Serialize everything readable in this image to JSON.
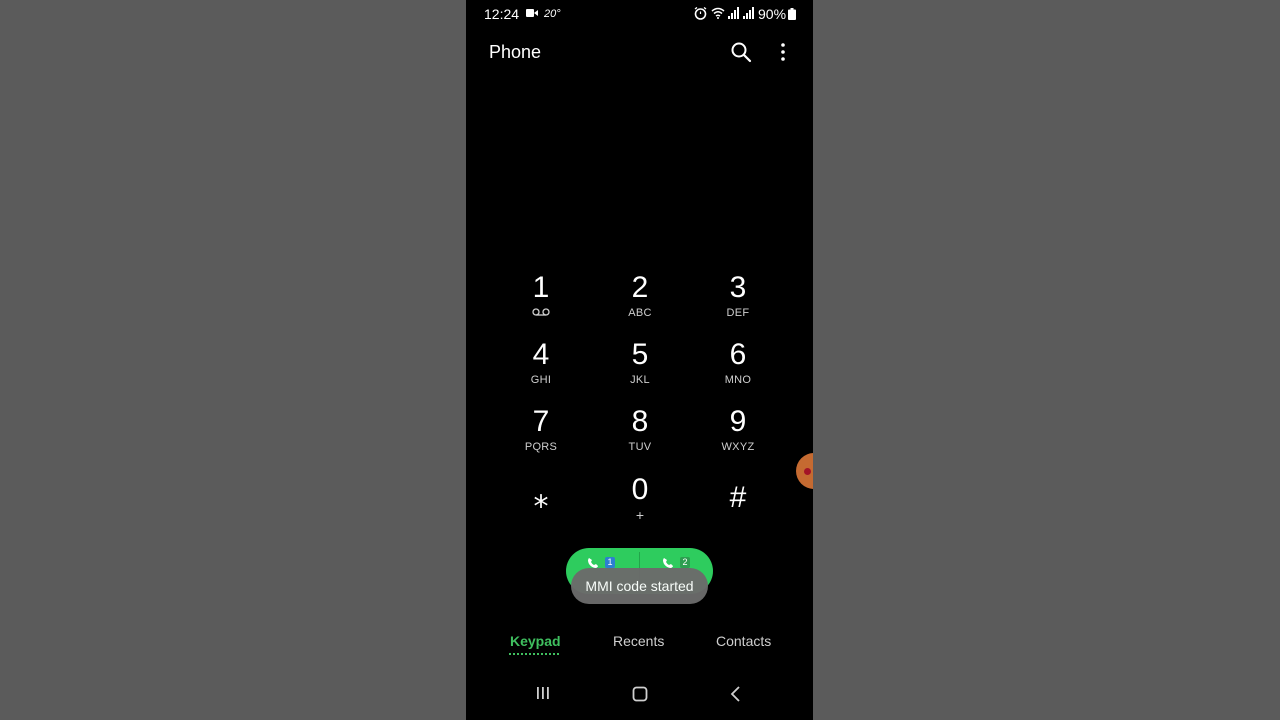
{
  "status_bar": {
    "time": "12:24",
    "temperature": "20°",
    "battery": "90%",
    "icons": [
      "video-icon",
      "alarm-icon",
      "wifi-icon",
      "signal-icon",
      "signal-icon",
      "battery-icon"
    ]
  },
  "header": {
    "title": "Phone",
    "search_icon": "search-icon",
    "more_icon": "more-vertical-icon"
  },
  "keypad": {
    "keys": [
      {
        "digit": "1",
        "letters": "",
        "icon": "voicemail-icon"
      },
      {
        "digit": "2",
        "letters": "ABC"
      },
      {
        "digit": "3",
        "letters": "DEF"
      },
      {
        "digit": "4",
        "letters": "GHI"
      },
      {
        "digit": "5",
        "letters": "JKL"
      },
      {
        "digit": "6",
        "letters": "MNO"
      },
      {
        "digit": "7",
        "letters": "PQRS"
      },
      {
        "digit": "8",
        "letters": "TUV"
      },
      {
        "digit": "9",
        "letters": "WXYZ"
      },
      {
        "digit": "⁎",
        "letters": ""
      },
      {
        "digit": "0",
        "letters": "+"
      },
      {
        "digit": "#",
        "letters": ""
      }
    ]
  },
  "call_buttons": {
    "sim1": "1",
    "sim2": "2",
    "color": "#2ecc5e"
  },
  "toast": {
    "message": "MMI code started"
  },
  "tabs": [
    {
      "label": "Keypad",
      "active": true
    },
    {
      "label": "Recents",
      "active": false
    },
    {
      "label": "Contacts",
      "active": false
    }
  ],
  "colors": {
    "accent": "#3fbf5f",
    "background": "#000000"
  }
}
